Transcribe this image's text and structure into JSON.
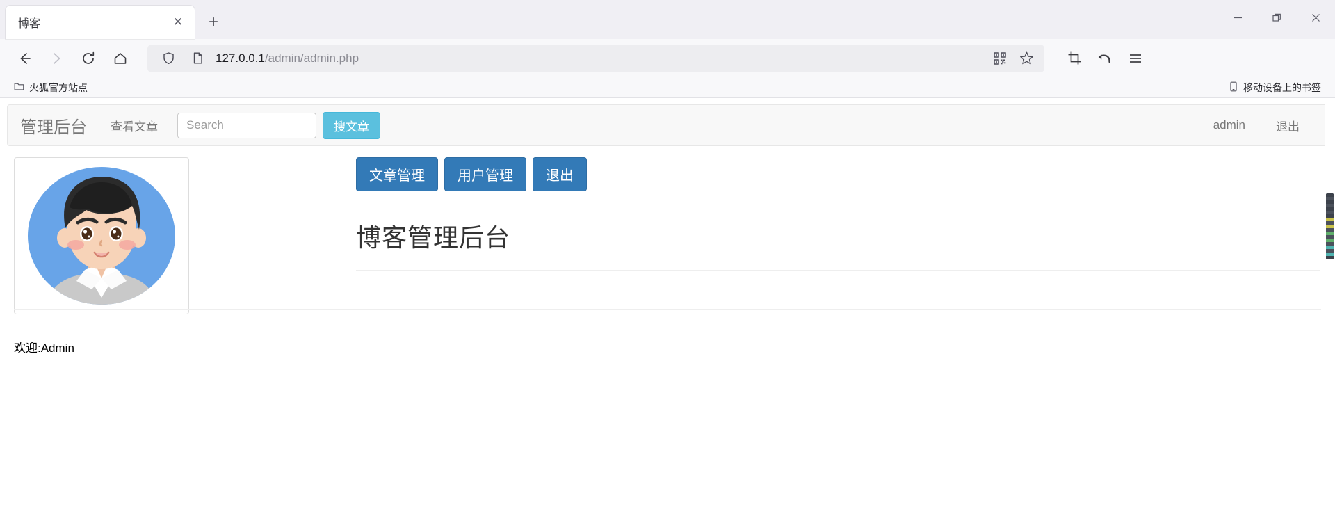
{
  "browser": {
    "tab": {
      "title": "博客",
      "close_label": "✕"
    },
    "newtab_label": "+",
    "window_controls": {
      "minimize": "—",
      "restore": "❐",
      "close": "✕"
    },
    "nav": {
      "back_icon": "back-arrow-icon",
      "forward_icon": "forward-arrow-icon",
      "reload_icon": "reload-icon",
      "home_icon": "home-icon"
    },
    "url": {
      "host": "127.0.0.1",
      "path": "/admin/admin.php",
      "shield_icon": "shield-icon",
      "page_icon": "page-document-icon",
      "qr_icon": "qr-code-icon",
      "star_icon": "star-bookmark-icon"
    },
    "toolbar_right": {
      "screenshot_icon": "crop-screenshot-icon",
      "undo_icon": "undo-arrow-icon",
      "menu_icon": "hamburger-menu-icon"
    },
    "bookmarks": {
      "items": [
        {
          "label": "火狐官方站点",
          "icon": "folder-icon"
        }
      ],
      "mobile": {
        "label": "移动设备上的书签",
        "icon": "mobile-phone-icon"
      }
    }
  },
  "site": {
    "navbar": {
      "brand": "管理后台",
      "links": [
        "查看文章"
      ],
      "search": {
        "value": "",
        "placeholder": "Search"
      },
      "search_button": "搜文章",
      "user": "admin",
      "logout": "退出"
    },
    "sidebar": {
      "avatar_alt": "user-avatar-illustration",
      "welcome": "欢迎:Admin"
    },
    "main": {
      "buttons": [
        "文章管理",
        "用户管理",
        "退出"
      ],
      "heading": "博客管理后台"
    }
  },
  "colors": {
    "primary": "#337ab7",
    "info": "#5bc0de",
    "avatar_bg": "#68a4e8",
    "hair": "#2b2b2b",
    "skin": "#f7d3b8",
    "shirt": "#c9c9c9"
  }
}
